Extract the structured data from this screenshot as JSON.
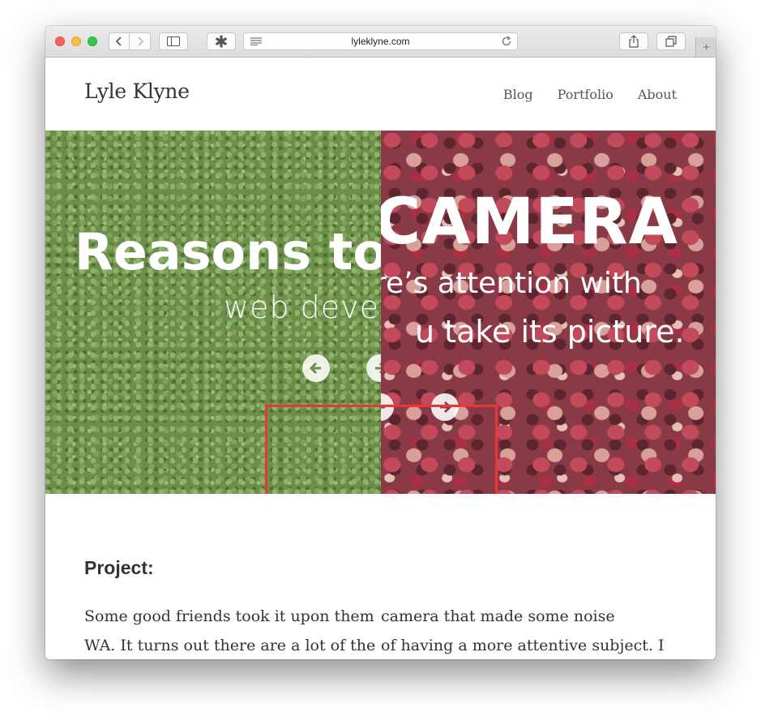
{
  "browser": {
    "url": "lyleklyne.com",
    "icons": {
      "back": "chevron-left-icon",
      "forward": "chevron-right-icon",
      "sidebar": "sidebar-icon",
      "extension": "asterisk-icon",
      "reader": "reader-lines-icon",
      "reload": "reload-icon",
      "share": "share-icon",
      "tabs": "tabs-overview-icon",
      "new_tab": "+"
    }
  },
  "site": {
    "title": "Lyle Klyne",
    "nav": [
      "Blog",
      "Portfolio",
      "About"
    ]
  },
  "hero": {
    "left_slide": {
      "title": "Reasons to",
      "subtitle": "web deve"
    },
    "right_slide": {
      "title": "CAMERA",
      "line1": "re’s attention with",
      "line2": "u take its picture."
    },
    "highlight_color": "#e53935"
  },
  "content": {
    "heading": "Project:",
    "paragraph_lines": [
      {
        "left": "Some good friends took it upon them",
        "right": "camera that made some noise"
      },
      {
        "left": "WA. It turns out there are a lot of the",
        "right": "of having a more attentive subject. I"
      }
    ]
  }
}
